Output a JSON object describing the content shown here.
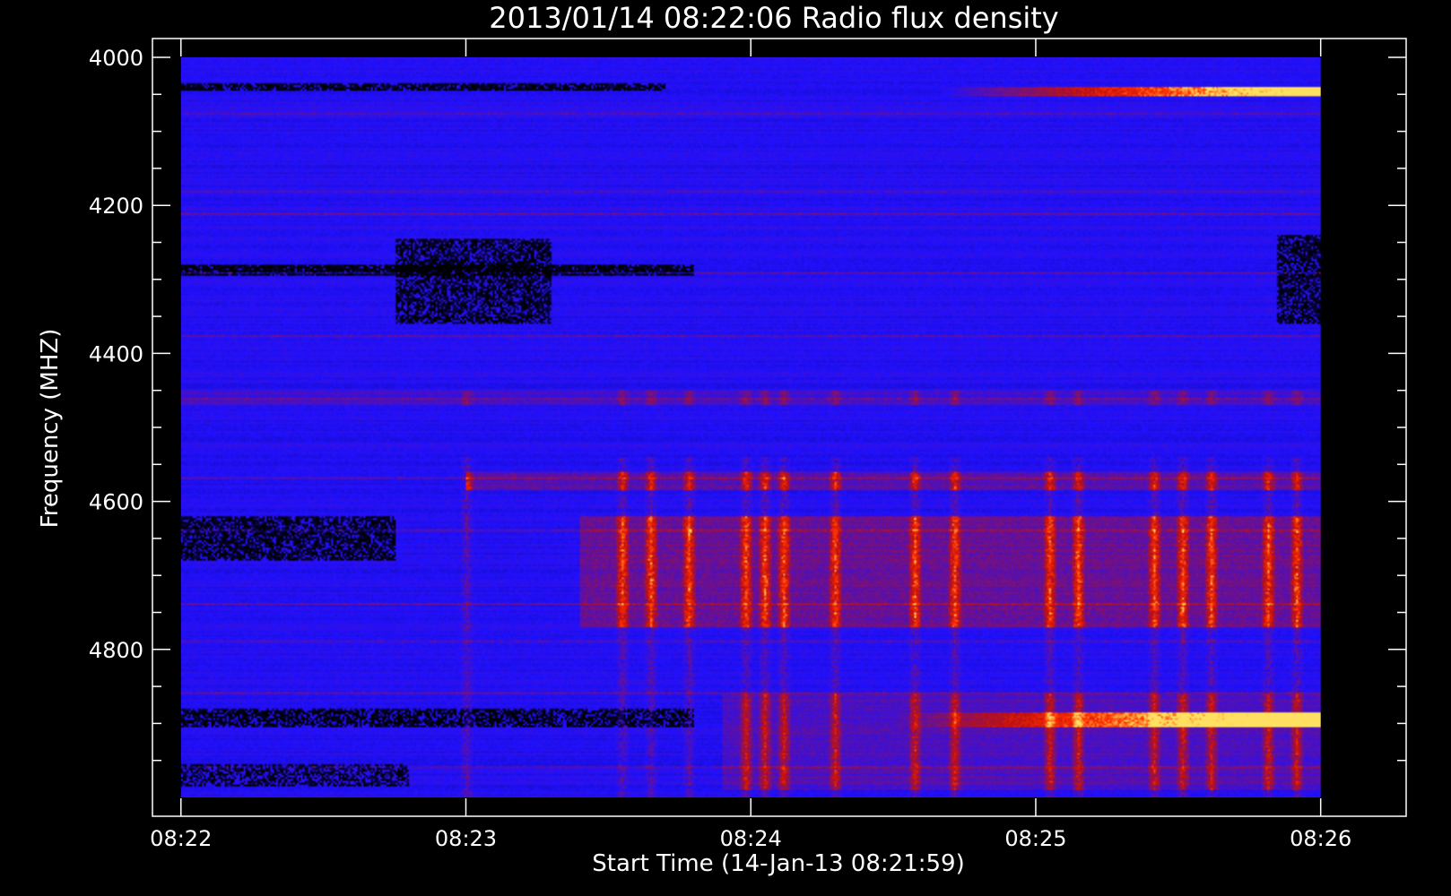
{
  "chart_data": {
    "type": "heatmap",
    "title": "2013/01/14 08:22:06 Radio flux density",
    "xlabel": "Start Time (14-Jan-13 08:21:59)",
    "ylabel": "Frequency (MHZ)",
    "x_range_minutes": [
      -0.1,
      4.3
    ],
    "data_extent_minutes": [
      0.0,
      4.0
    ],
    "ylim": [
      4000,
      5000
    ],
    "y_inverted": true,
    "x_major_ticks": [
      {
        "value": 0,
        "label": "08:22"
      },
      {
        "value": 1,
        "label": "08:23"
      },
      {
        "value": 2,
        "label": "08:24"
      },
      {
        "value": 3,
        "label": "08:25"
      },
      {
        "value": 4,
        "label": "08:26"
      }
    ],
    "x_minor_step": 0.333333,
    "y_major_ticks": [
      {
        "value": 4000,
        "label": "4000"
      },
      {
        "value": 4200,
        "label": "4200"
      },
      {
        "value": 4400,
        "label": "4400"
      },
      {
        "value": 4600,
        "label": "4600"
      },
      {
        "value": 4800,
        "label": "4800"
      }
    ],
    "y_minor_step": 50,
    "colormap": [
      "#000000",
      "#2010ff",
      "#c01010",
      "#ff3000",
      "#ffe060"
    ],
    "background_level_color": "#2010ff",
    "features": [
      {
        "kind": "emission",
        "f1": 4040,
        "f2": 4052,
        "t1": 2.65,
        "t2": 4.0,
        "rise": "linear",
        "max_intensity": 1.0
      },
      {
        "kind": "emission",
        "f1": 4885,
        "f2": 4905,
        "t1": 2.5,
        "t2": 4.0,
        "rise": "linear",
        "max_intensity": 1.0
      },
      {
        "kind": "emission",
        "f1": 4560,
        "f2": 4585,
        "t1": 1.0,
        "t2": 4.0,
        "rise": "flat",
        "max_intensity": 0.45
      },
      {
        "kind": "emission",
        "f1": 4620,
        "f2": 4770,
        "t1": 1.4,
        "t2": 4.0,
        "rise": "flat",
        "max_intensity": 0.55
      },
      {
        "kind": "emission",
        "f1": 4860,
        "f2": 4990,
        "t1": 1.9,
        "t2": 4.0,
        "rise": "flat",
        "max_intensity": 0.35
      },
      {
        "kind": "emission",
        "f1": 4450,
        "f2": 4470,
        "t1": 0.0,
        "t2": 4.0,
        "rise": "flat",
        "max_intensity": 0.25
      },
      {
        "kind": "dropout",
        "f1": 4280,
        "f2": 4295,
        "t1": 0.0,
        "t2": 1.8,
        "max_intensity": 0.9
      },
      {
        "kind": "dropout",
        "f1": 4245,
        "f2": 4360,
        "t1": 0.75,
        "t2": 1.3,
        "max_intensity": 0.7
      },
      {
        "kind": "dropout",
        "f1": 4620,
        "f2": 4680,
        "t1": 0.0,
        "t2": 0.75,
        "max_intensity": 0.75
      },
      {
        "kind": "dropout",
        "f1": 4880,
        "f2": 4905,
        "t1": 0.0,
        "t2": 1.8,
        "max_intensity": 0.7
      },
      {
        "kind": "dropout",
        "f1": 4955,
        "f2": 4985,
        "t1": 0.0,
        "t2": 0.8,
        "max_intensity": 0.6
      },
      {
        "kind": "dropout",
        "f1": 4240,
        "f2": 4360,
        "t1": 3.85,
        "t2": 4.0,
        "max_intensity": 0.7
      },
      {
        "kind": "dropout",
        "f1": 4035,
        "f2": 4045,
        "t1": 0.0,
        "t2": 1.7,
        "max_intensity": 0.8
      }
    ],
    "burst_columns_minutes": [
      1.0,
      1.55,
      1.65,
      1.78,
      1.98,
      2.05,
      2.12,
      2.3,
      2.58,
      2.72,
      3.05,
      3.15,
      3.42,
      3.52,
      3.62,
      3.82,
      3.92
    ],
    "narrow_lines_mhz": [
      4075,
      4180,
      4210,
      4290,
      4375,
      4460,
      4570,
      4640,
      4740,
      4790,
      4860,
      4960
    ]
  }
}
